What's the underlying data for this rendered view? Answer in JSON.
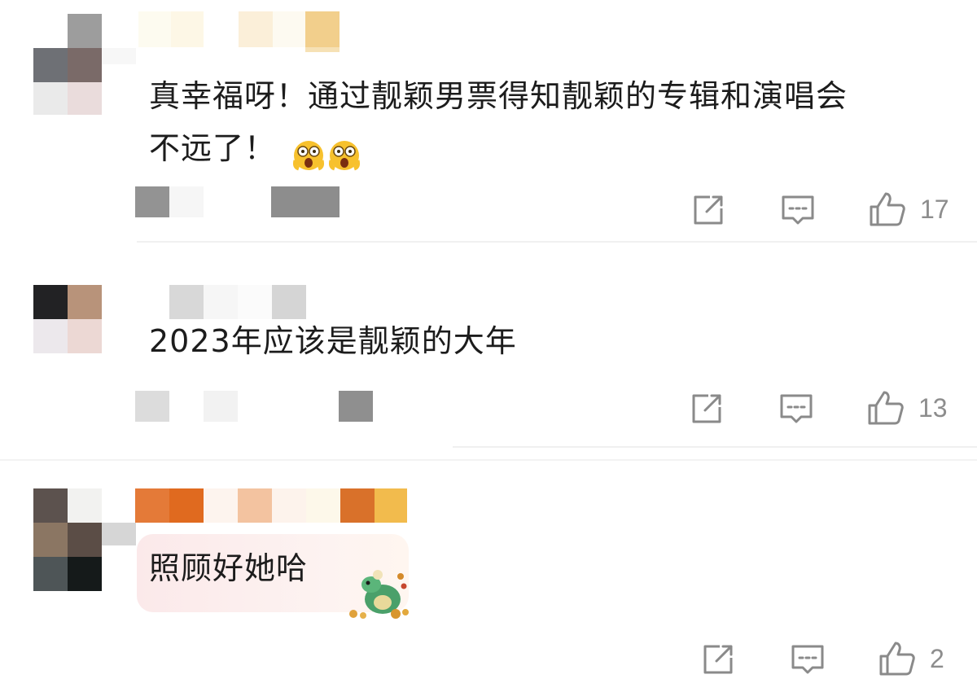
{
  "comments": [
    {
      "text_line1": "真幸福呀！通过靓颖男票得知靓颖的专辑和演唱会",
      "text_line2": "不远了！",
      "emoji": "shocked-emoji",
      "likes": "17",
      "icons": [
        "share-icon",
        "comment-icon",
        "like-icon"
      ]
    },
    {
      "text_line1": "2023年应该是靓颖的大年",
      "likes": "13",
      "icons": [
        "share-icon",
        "comment-icon",
        "like-icon"
      ]
    },
    {
      "text_line1": "照顾好她哈",
      "sticker": "cartoon-dinosaur-sticker",
      "likes": "2",
      "icons": [
        "share-icon",
        "comment-icon",
        "like-icon"
      ]
    }
  ],
  "colors": {
    "text": "#1c1c1c",
    "icon": "#8a8a8a",
    "divider": "#f0f0f0"
  }
}
